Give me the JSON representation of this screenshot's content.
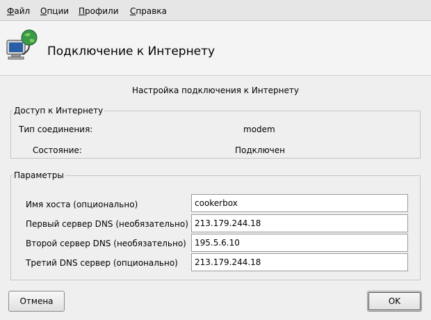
{
  "menu": [
    {
      "underline": "Ф",
      "rest": "айл"
    },
    {
      "underline": "О",
      "rest": "пции"
    },
    {
      "underline": "П",
      "rest": "рофили"
    },
    {
      "underline": "С",
      "rest": "правка"
    }
  ],
  "header": {
    "title": "Подключение к Интернету",
    "icon": "network-connection-icon"
  },
  "subtitle": "Настройка подключения к Интернету",
  "access": {
    "legend": "Доступ к Интернету",
    "type_label": "Тип соединения:",
    "type_value": "modem",
    "state_label": "Состояние:",
    "state_value": "Подключен"
  },
  "params": {
    "legend": "Параметры",
    "fields": [
      {
        "label": "Имя хоста (опционально)",
        "value": "cookerbox"
      },
      {
        "label": "Первый сервер DNS (необязательно)",
        "value": "213.179.244.18"
      },
      {
        "label": "Второй сервер DNS (необязательно)",
        "value": "195.5.6.10"
      },
      {
        "label": "Третий DNS сервер (опционально)",
        "value": "213.179.244.18"
      }
    ]
  },
  "buttons": {
    "cancel": "Отмена",
    "ok": "OK"
  }
}
